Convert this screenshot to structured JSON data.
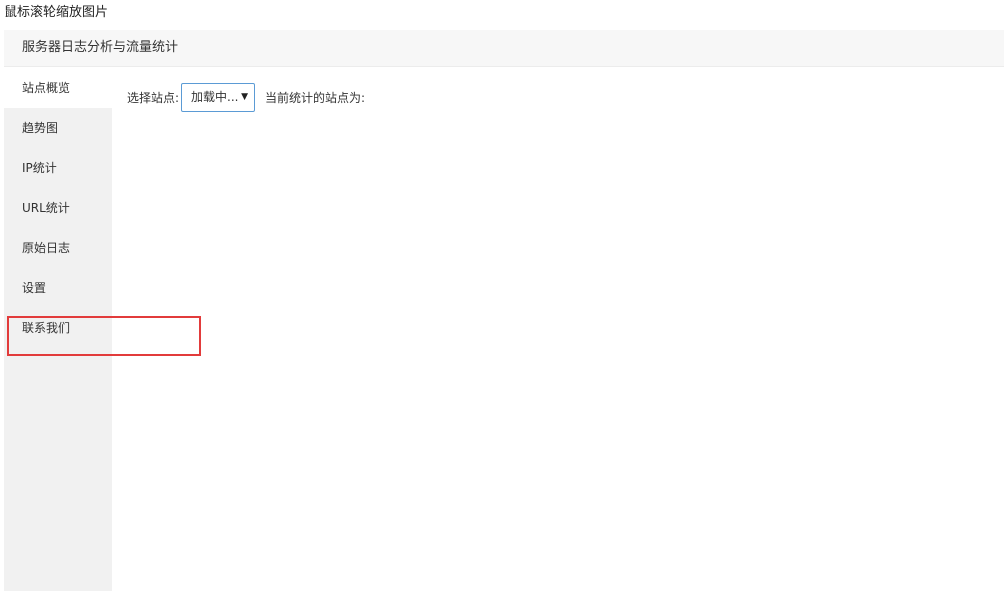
{
  "caption": "鼠标滚轮缩放图片",
  "header": {
    "title": "服务器日志分析与流量统计"
  },
  "sidebar": {
    "items": [
      {
        "label": "站点概览"
      },
      {
        "label": "趋势图"
      },
      {
        "label": "IP统计"
      },
      {
        "label": "URL统计"
      },
      {
        "label": "原始日志"
      },
      {
        "label": "设置"
      },
      {
        "label": "联系我们"
      }
    ]
  },
  "toolbar": {
    "select_site_label": "选择站点:",
    "site_select_value": "加载中...",
    "caret_icon": "▼",
    "current_site_label": "当前统计的站点为:"
  },
  "colors": {
    "highlight": "#e23b3b",
    "select_border": "#5b9bd5",
    "sidebar_bg": "#f1f1f1",
    "header_bg": "#f7f7f7"
  }
}
